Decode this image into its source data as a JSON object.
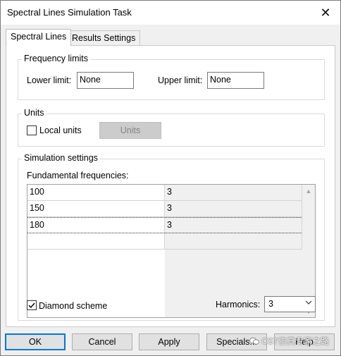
{
  "window": {
    "title": "Spectral Lines Simulation Task",
    "close_glyph": "✕"
  },
  "tabs": [
    {
      "label": "Spectral Lines",
      "active": true
    },
    {
      "label": "Results Settings",
      "active": false
    }
  ],
  "frequency_limits": {
    "legend": "Frequency limits",
    "lower_label": "Lower limit:",
    "lower_value": "None",
    "upper_label": "Upper limit:",
    "upper_value": "None"
  },
  "units": {
    "legend": "Units",
    "local_units_label": "Local units",
    "local_units_checked": false,
    "units_button": "Units"
  },
  "simulation": {
    "legend": "Simulation settings",
    "fundamental_label": "Fundamental frequencies:",
    "rows": [
      {
        "freq": "100",
        "value": "3"
      },
      {
        "freq": "150",
        "value": "3"
      },
      {
        "freq": "180",
        "value": "3"
      }
    ],
    "diamond_label": "Diamond scheme",
    "diamond_checked": true,
    "harmonics_label": "Harmonics:",
    "harmonics_value": "3"
  },
  "buttons": {
    "ok": "OK",
    "cancel": "Cancel",
    "apply": "Apply",
    "specials": "Specials...",
    "help": "Help"
  },
  "watermark": {
    "text": "CST仿真专家之路"
  },
  "colors": {
    "accent": "#0078d7",
    "disabled_bg": "#cccccc"
  }
}
